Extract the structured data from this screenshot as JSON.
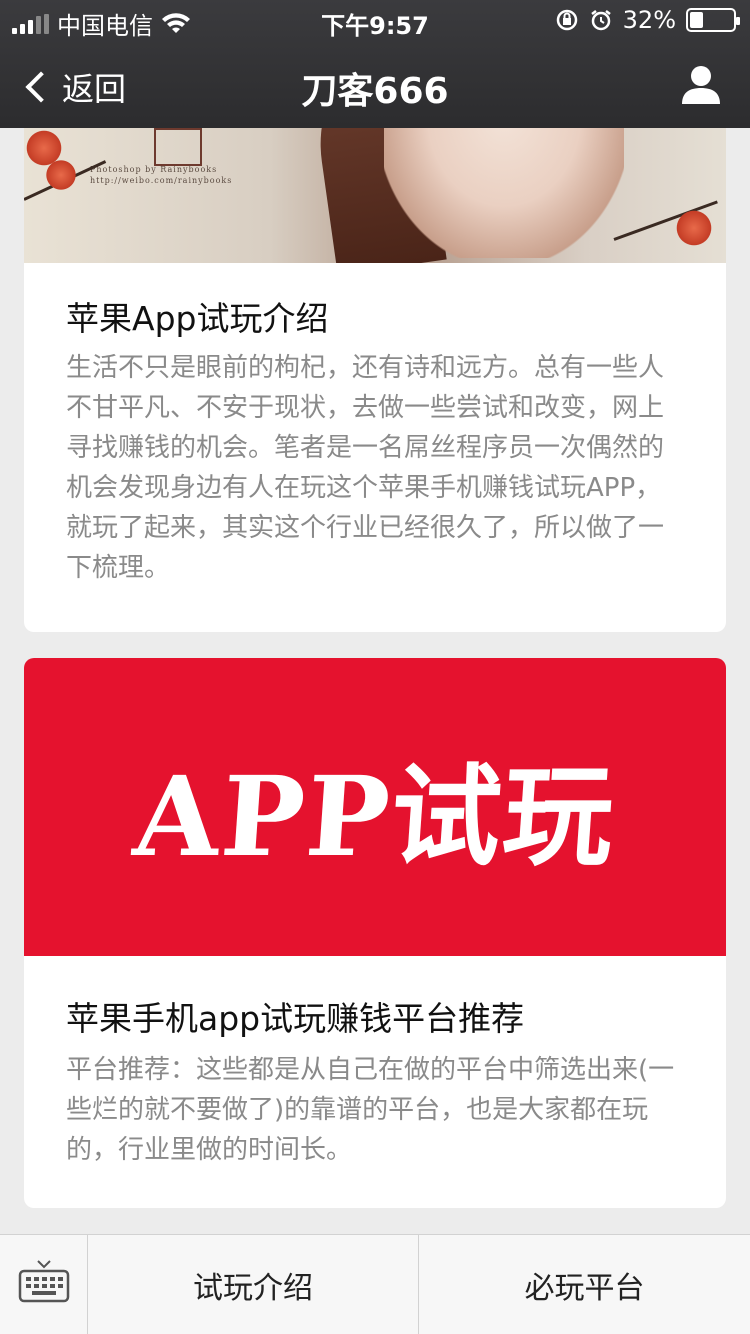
{
  "status_bar": {
    "carrier": "中国电信",
    "time": "下午9:57",
    "battery_percent": "32%",
    "battery_level": 0.32,
    "icons": [
      "signal-icon",
      "wifi-icon",
      "orientation-lock-icon",
      "alarm-icon",
      "battery-icon"
    ]
  },
  "nav": {
    "back_label": "返回",
    "title": "刀客666",
    "profile_icon": "person-icon"
  },
  "articles": [
    {
      "image_credit_line1": "Photoshop by Rainybooks",
      "image_credit_line2": "http://weibo.com/rainybooks",
      "title": "苹果App试玩介绍",
      "description": "生活不只是眼前的枸杞，还有诗和远方。总有一些人不甘平凡、不安于现状，去做一些尝试和改变，网上寻找赚钱的机会。笔者是一名屌丝程序员一次偶然的机会发现身边有人在玩这个苹果手机赚钱试玩APP，就玩了起来，其实这个行业已经很久了，所以做了一下梳理。"
    },
    {
      "image_text": "APP试玩",
      "image_bg_color": "#e5122e",
      "title": "苹果手机app试玩赚钱平台推荐",
      "description": "平台推荐：这些都是从自己在做的平台中筛选出来(一些烂的就不要做了)的靠谱的平台，也是大家都在玩的，行业里做的时间长。"
    }
  ],
  "bottom_menu": {
    "keyboard_icon": "keyboard-icon",
    "items": [
      {
        "label": "试玩介绍"
      },
      {
        "label": "必玩平台"
      }
    ]
  }
}
